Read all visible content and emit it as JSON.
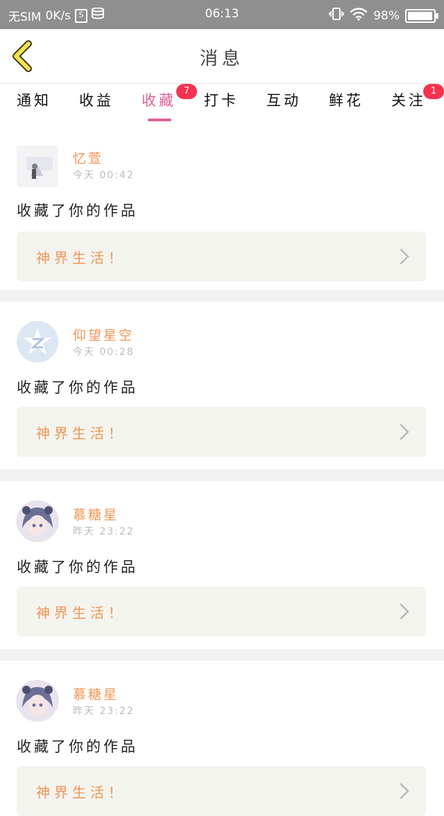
{
  "status_bar": {
    "carrier": "无SIM",
    "speed": "0K/s",
    "sim_icon_label": "S",
    "time": "06:13",
    "battery": "98%",
    "icons": [
      "sim-icon",
      "storage-icon",
      "vibrate-icon",
      "wifi-icon",
      "battery-icon"
    ]
  },
  "header": {
    "title": "消息",
    "back_icon": "chevron-left-icon",
    "back_color": "#f7e14a"
  },
  "tabs": [
    {
      "label": "通知",
      "badge": null,
      "active": false
    },
    {
      "label": "收益",
      "badge": null,
      "active": false
    },
    {
      "label": "收藏",
      "badge": "7",
      "active": true
    },
    {
      "label": "打卡",
      "badge": null,
      "active": false
    },
    {
      "label": "互动",
      "badge": null,
      "active": false
    },
    {
      "label": "鲜花",
      "badge": null,
      "active": false
    },
    {
      "label": "关注",
      "badge": "1",
      "active": false
    }
  ],
  "colors": {
    "accent": "#e0609a",
    "username": "#f09554",
    "badge": "#f5334f"
  },
  "messages": [
    {
      "username": "忆萱",
      "time": "今天 00:42",
      "action": "收藏了你的作品",
      "work_title": "神界生活！",
      "avatar_icon": "photo-thumbnail"
    },
    {
      "username": "仰望星空",
      "time": "今天 00:28",
      "action": "收藏了你的作品",
      "work_title": "神界生活！",
      "avatar_icon": "qq-logo"
    },
    {
      "username": "慕糖星",
      "time": "昨天 23:22",
      "action": "收藏了你的作品",
      "work_title": "神界生活！",
      "avatar_icon": "anime-avatar"
    },
    {
      "username": "慕糖星",
      "time": "昨天 23:22",
      "action": "收藏了你的作品",
      "work_title": "神界生活！",
      "avatar_icon": "anime-avatar"
    }
  ]
}
